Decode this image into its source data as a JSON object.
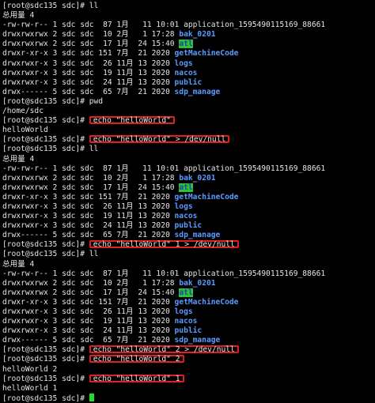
{
  "terminal": {
    "prompt": "[root@sdc135 sdc]# ",
    "colors": {
      "background": "#000000",
      "text": "#e6e6e6",
      "dir": "#5b9bff",
      "highlight_bg": "#2ec42e",
      "box": "#e02020",
      "cursor": "#22dd22"
    },
    "lines": [
      {
        "type": "prompt",
        "cmd": "ll",
        "boxed": false
      },
      {
        "type": "text",
        "text": "总用量 4"
      },
      {
        "type": "ls",
        "meta": "-rw-rw-r-- 1 sdc sdc  87 1月   11 10:01 ",
        "name": "application_1595490115169_88661",
        "style": "file"
      },
      {
        "type": "ls",
        "meta": "drwxrwxrwx 2 sdc sdc  10 2月   1 17:28 ",
        "name": "bak_0201",
        "style": "dir"
      },
      {
        "type": "ls",
        "meta": "drwxrwxrwx 2 sdc sdc  17 1月  24 15:40 ",
        "name": "atl",
        "style": "dir-hl"
      },
      {
        "type": "ls",
        "meta": "drwxr-xr-x 3 sdc sdc 151 7月  21 2020 ",
        "name": "getMachineCode",
        "style": "dir"
      },
      {
        "type": "ls",
        "meta": "drwxrwxr-x 3 sdc sdc  26 11月 13 2020 ",
        "name": "logs",
        "style": "dir"
      },
      {
        "type": "ls",
        "meta": "drwxrwxr-x 3 sdc sdc  19 11月 13 2020 ",
        "name": "nacos",
        "style": "dir"
      },
      {
        "type": "ls",
        "meta": "drwxrwxr-x 3 sdc sdc  24 11月 13 2020 ",
        "name": "public",
        "style": "dir"
      },
      {
        "type": "ls",
        "meta": "drwx------ 5 sdc sdc  65 7月  21 2020 ",
        "name": "sdp_manage",
        "style": "dir"
      },
      {
        "type": "prompt",
        "cmd": "pwd",
        "boxed": false
      },
      {
        "type": "text",
        "text": "/home/sdc"
      },
      {
        "type": "prompt",
        "cmd": "echo \"helloWorld\"",
        "boxed": true
      },
      {
        "type": "text",
        "text": "helloWorld"
      },
      {
        "type": "prompt",
        "cmd": "echo \"helloWorld\" > /dev/null",
        "boxed": true
      },
      {
        "type": "prompt",
        "cmd": "ll",
        "boxed": false
      },
      {
        "type": "text",
        "text": "总用量 4"
      },
      {
        "type": "ls",
        "meta": "-rw-rw-r-- 1 sdc sdc  87 1月   11 10:01 ",
        "name": "application_1595490115169_88661",
        "style": "file"
      },
      {
        "type": "ls",
        "meta": "drwxrwxrwx 2 sdc sdc  10 2月   1 17:28 ",
        "name": "bak_0201",
        "style": "dir"
      },
      {
        "type": "ls",
        "meta": "drwxrwxrwx 2 sdc sdc  17 1月  24 15:40 ",
        "name": "atl",
        "style": "dir-hl"
      },
      {
        "type": "ls",
        "meta": "drwxr-xr-x 3 sdc sdc 151 7月  21 2020 ",
        "name": "getMachineCode",
        "style": "dir"
      },
      {
        "type": "ls",
        "meta": "drwxrwxr-x 3 sdc sdc  26 11月 13 2020 ",
        "name": "logs",
        "style": "dir"
      },
      {
        "type": "ls",
        "meta": "drwxrwxr-x 3 sdc sdc  19 11月 13 2020 ",
        "name": "nacos",
        "style": "dir"
      },
      {
        "type": "ls",
        "meta": "drwxrwxr-x 3 sdc sdc  24 11月 13 2020 ",
        "name": "public",
        "style": "dir"
      },
      {
        "type": "ls",
        "meta": "drwx------ 5 sdc sdc  65 7月  21 2020 ",
        "name": "sdp_manage",
        "style": "dir"
      },
      {
        "type": "prompt",
        "cmd": "echo \"helloWorld\" 1 > /dev/null",
        "boxed": true
      },
      {
        "type": "prompt",
        "cmd": "ll",
        "boxed": false
      },
      {
        "type": "text",
        "text": "总用量 4"
      },
      {
        "type": "ls",
        "meta": "-rw-rw-r-- 1 sdc sdc  87 1月   11 10:01 ",
        "name": "application_1595490115169_88661",
        "style": "file"
      },
      {
        "type": "ls",
        "meta": "drwxrwxrwx 2 sdc sdc  10 2月   1 17:28 ",
        "name": "bak_0201",
        "style": "dir"
      },
      {
        "type": "ls",
        "meta": "drwxrwxrwx 2 sdc sdc  17 1月  24 15:40 ",
        "name": "atl",
        "style": "dir-hl"
      },
      {
        "type": "ls",
        "meta": "drwxr-xr-x 3 sdc sdc 151 7月  21 2020 ",
        "name": "getMachineCode",
        "style": "dir"
      },
      {
        "type": "ls",
        "meta": "drwxrwxr-x 3 sdc sdc  26 11月 13 2020 ",
        "name": "logs",
        "style": "dir"
      },
      {
        "type": "ls",
        "meta": "drwxrwxr-x 3 sdc sdc  19 11月 13 2020 ",
        "name": "nacos",
        "style": "dir"
      },
      {
        "type": "ls",
        "meta": "drwxrwxr-x 3 sdc sdc  24 11月 13 2020 ",
        "name": "public",
        "style": "dir"
      },
      {
        "type": "ls",
        "meta": "drwx------ 5 sdc sdc  65 7月  21 2020 ",
        "name": "sdp_manage",
        "style": "dir"
      },
      {
        "type": "prompt",
        "cmd": "echo \"helloWorld\" 2 > /dev/null",
        "boxed": true
      },
      {
        "type": "prompt",
        "cmd": "echo \"helloWorld\" 2",
        "boxed": true
      },
      {
        "type": "text",
        "text": "helloWorld 2"
      },
      {
        "type": "prompt",
        "cmd": "echo \"helloWorld\" 1",
        "boxed": true
      },
      {
        "type": "text",
        "text": "helloWorld 1"
      },
      {
        "type": "prompt",
        "cmd": "",
        "boxed": false,
        "cursor": true
      }
    ]
  }
}
